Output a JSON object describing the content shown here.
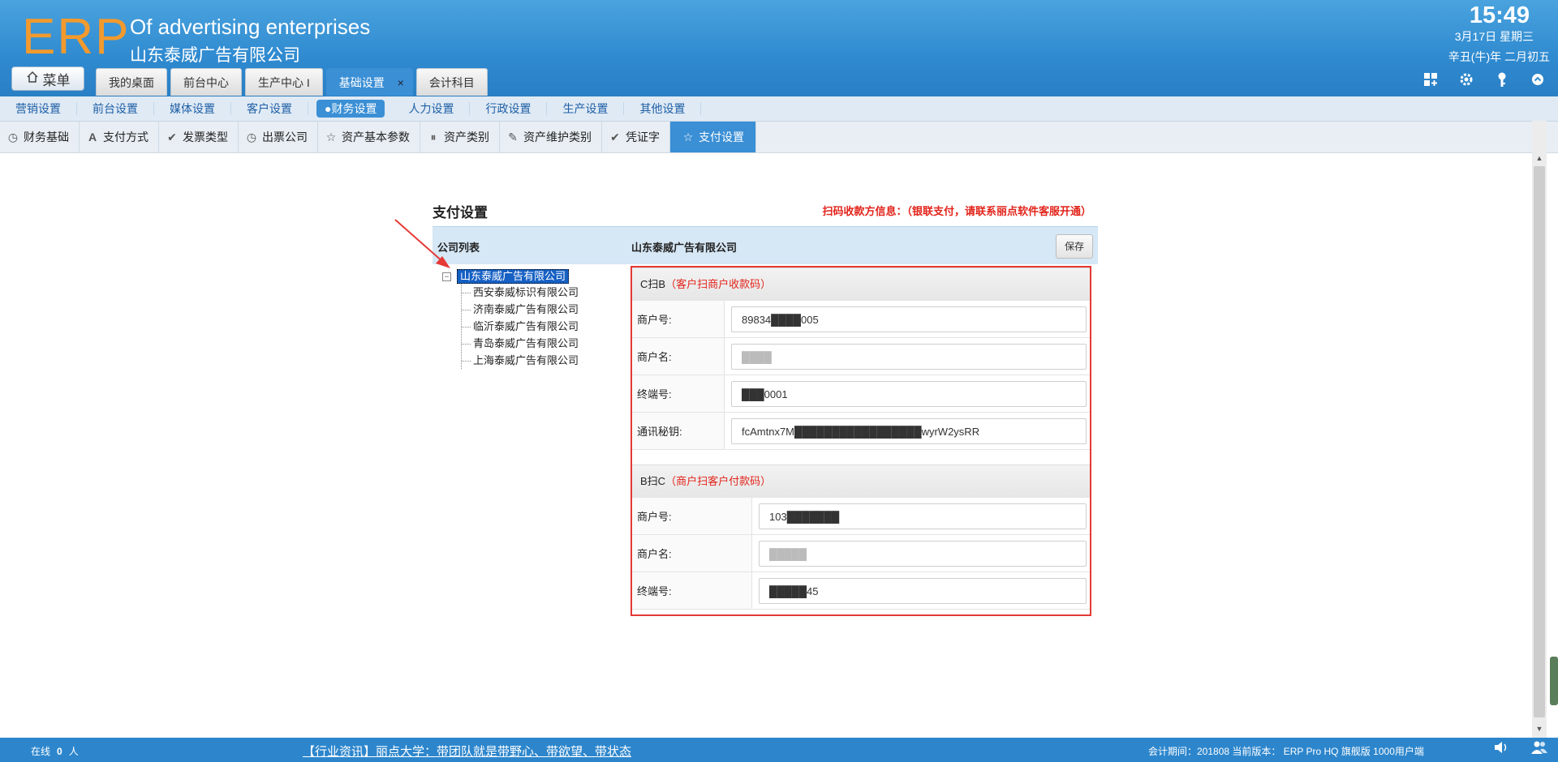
{
  "header": {
    "logo": "ERP",
    "company_en": "Of advertising enterprises",
    "company_cn": "山东泰威广告有限公司",
    "time": "15:49",
    "date": "3月17日 星期三",
    "lunar": "辛丑(牛)年 二月初五",
    "menu_label": "菜单",
    "icons": [
      "dashboard-icon",
      "gear-icon",
      "key-icon",
      "logout-icon"
    ]
  },
  "main_tabs": [
    {
      "label": "我的桌面"
    },
    {
      "label": "前台中心"
    },
    {
      "label": "生产中心 I"
    },
    {
      "label": "基础设置",
      "active": true
    },
    {
      "label": "会计科目"
    }
  ],
  "main_tab_close": "×",
  "subnav": [
    {
      "label": "营销设置"
    },
    {
      "label": "前台设置"
    },
    {
      "label": "媒体设置"
    },
    {
      "label": "客户设置"
    },
    {
      "label": "●财务设置",
      "active": true
    },
    {
      "label": "人力设置"
    },
    {
      "label": "行政设置"
    },
    {
      "label": "生产设置"
    },
    {
      "label": "其他设置"
    }
  ],
  "toolbar": [
    {
      "label": "财务基础",
      "icon": "clock-icon"
    },
    {
      "label": "支付方式",
      "icon": "letter-a-icon"
    },
    {
      "label": "发票类型",
      "icon": "check-icon"
    },
    {
      "label": "出票公司",
      "icon": "clock-icon"
    },
    {
      "label": "资产基本参数",
      "icon": "star-icon"
    },
    {
      "label": "资产类别",
      "icon": "pause-icon"
    },
    {
      "label": "资产维护类别",
      "icon": "pencil-icon"
    },
    {
      "label": "凭证字",
      "icon": "check-icon"
    },
    {
      "label": "支付设置",
      "icon": "star-icon",
      "active": true
    }
  ],
  "page": {
    "title": "支付设置",
    "notice": "扫码收款方信息：（银联支付，请联系丽点软件客服开通）",
    "list_header": "公司列表",
    "selected_company": "山东泰威广告有限公司",
    "save_label": "保存"
  },
  "tree": {
    "root": "山东泰威广告有限公司",
    "toggle": "−",
    "children": [
      "西安泰威标识有限公司",
      "济南泰威广告有限公司",
      "临沂泰威广告有限公司",
      "青岛泰威广告有限公司",
      "上海泰威广告有限公司"
    ]
  },
  "c2b": {
    "title": "C扫B",
    "subtitle": "（客户扫商户收款码）",
    "merchant_no_label": "商户号:",
    "merchant_no": "89834████005",
    "merchant_name_label": "商户名:",
    "merchant_name": "████",
    "terminal_no_label": "终端号:",
    "terminal_no": "███0001",
    "secret_label": "通讯秘钥:",
    "secret": "fcAmtnx7M█████████████████wyrW2ysRR"
  },
  "b2c": {
    "title": "B扫C",
    "subtitle": "（商户扫客户付款码）",
    "merchant_no_label": "商户号:",
    "merchant_no": "103███████",
    "merchant_name_label": "商户名:",
    "merchant_name": "█████",
    "terminal_no_label": "终端号:",
    "terminal_no": "█████45"
  },
  "statusbar": {
    "online_prefix": "在线",
    "online_count": "0",
    "online_suffix": "人",
    "news": "【行业资讯】丽点大学：带团队就是带野心、带欲望、带状态",
    "info": "会计期间：201808 当前版本： ERP Pro HQ 旗舰版 1000用户端",
    "icons": [
      "speaker-icon",
      "users-icon"
    ]
  },
  "colors": {
    "header_blue": "#2f8ad0",
    "logo_orange": "#f29a2e",
    "notice_red": "#e2231a",
    "form_border_red": "#e53935",
    "tree_selected": "#1660c4"
  }
}
